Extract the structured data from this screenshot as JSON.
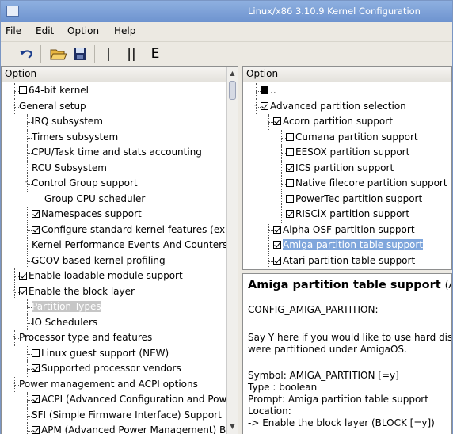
{
  "window": {
    "title": "Linux/x86 3.10.9 Kernel Configuration"
  },
  "menubar": {
    "file": "File",
    "edit": "Edit",
    "option": "Option",
    "help": "Help"
  },
  "toolbar": {
    "back_icon": "undo-arrow-icon",
    "open_icon": "open-folder-icon",
    "save_icon": "floppy-save-icon",
    "single_label": "|",
    "split_label": "||",
    "full_label": "E"
  },
  "left_pane": {
    "header": "Option",
    "items": [
      {
        "label": "64-bit kernel",
        "check": "off",
        "depth": 0
      },
      {
        "label": "General setup",
        "check": "none",
        "depth": 0,
        "expander": "-"
      },
      {
        "label": "IRQ subsystem",
        "check": "none",
        "depth": 1
      },
      {
        "label": "Timers subsystem",
        "check": "none",
        "depth": 1
      },
      {
        "label": "CPU/Task time and stats accounting",
        "check": "none",
        "depth": 1
      },
      {
        "label": "RCU Subsystem",
        "check": "none",
        "depth": 1
      },
      {
        "label": "Control Group support",
        "check": "none",
        "depth": 1,
        "expander": "-"
      },
      {
        "label": "Group CPU scheduler",
        "check": "none",
        "depth": 2
      },
      {
        "label": "Namespaces support",
        "check": "on",
        "depth": 1
      },
      {
        "label": "Configure standard kernel features (ex",
        "check": "on",
        "depth": 1
      },
      {
        "label": "Kernel Performance Events And Counters",
        "check": "none",
        "depth": 1
      },
      {
        "label": "GCOV-based kernel profiling",
        "check": "none",
        "depth": 1
      },
      {
        "label": "Enable loadable module support",
        "check": "on",
        "depth": 0
      },
      {
        "label": "Enable the block layer",
        "check": "on",
        "depth": 0,
        "expander": "-"
      },
      {
        "label": "Partition Types",
        "check": "none",
        "depth": 1,
        "selected": true
      },
      {
        "label": "IO Schedulers",
        "check": "none",
        "depth": 1
      },
      {
        "label": "Processor type and features",
        "check": "none",
        "depth": 0,
        "expander": "-"
      },
      {
        "label": "Linux guest support (NEW)",
        "check": "off",
        "depth": 1
      },
      {
        "label": "Supported processor vendors",
        "check": "on",
        "depth": 1
      },
      {
        "label": "Power management and ACPI options",
        "check": "none",
        "depth": 0,
        "expander": "-"
      },
      {
        "label": "ACPI (Advanced Configuration and Pow",
        "check": "on",
        "depth": 1
      },
      {
        "label": "SFI (Simple Firmware Interface) Support",
        "check": "none",
        "depth": 1
      },
      {
        "label": "APM (Advanced Power Management) B",
        "check": "on",
        "depth": 1
      }
    ]
  },
  "right_pane": {
    "header": "Option",
    "items": [
      {
        "label": "..",
        "check": "back",
        "depth": 0
      },
      {
        "label": "Advanced partition selection",
        "check": "on",
        "depth": 0,
        "expander": "-"
      },
      {
        "label": "Acorn partition support",
        "check": "on",
        "depth": 1,
        "expander": "-"
      },
      {
        "label": "Cumana partition support",
        "check": "off",
        "depth": 2
      },
      {
        "label": "EESOX partition support",
        "check": "off",
        "depth": 2
      },
      {
        "label": "ICS partition support",
        "check": "on",
        "depth": 2
      },
      {
        "label": "Native filecore partition support",
        "check": "off",
        "depth": 2
      },
      {
        "label": "PowerTec partition support",
        "check": "off",
        "depth": 2
      },
      {
        "label": "RISCiX partition support",
        "check": "on",
        "depth": 2
      },
      {
        "label": "Alpha OSF partition support",
        "check": "on",
        "depth": 1
      },
      {
        "label": "Amiga partition table support",
        "check": "on",
        "depth": 1,
        "selected": true
      },
      {
        "label": "Atari partition table support",
        "check": "on",
        "depth": 1
      }
    ]
  },
  "help": {
    "title": "Amiga partition table support",
    "title_sym": "(AMIG",
    "config": "CONFIG_AMIGA_PARTITION:",
    "desc1": "Say Y here if you would like to use hard disks",
    "desc2": "were partitioned under AmigaOS.",
    "symbol": "Symbol: AMIGA_PARTITION [=y]",
    "type": "Type : boolean",
    "prompt": "Prompt: Amiga partition table support",
    "location": "Location:",
    "loc1": "-> Enable the block layer (BLOCK [=y])"
  }
}
